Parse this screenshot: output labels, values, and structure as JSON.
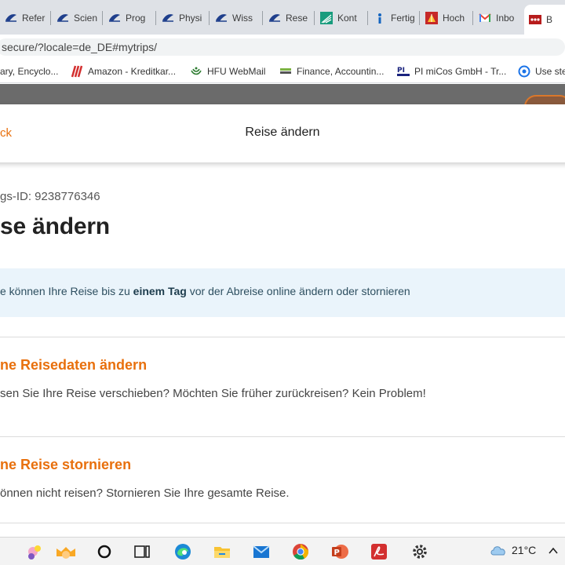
{
  "browser": {
    "tabs": [
      {
        "label": "Refer",
        "icon": "sailboat-icon"
      },
      {
        "label": "Scien",
        "icon": "sailboat-icon"
      },
      {
        "label": "Prog",
        "icon": "sailboat-icon"
      },
      {
        "label": "Physi",
        "icon": "sailboat-icon"
      },
      {
        "label": "Wiss",
        "icon": "sailboat-icon"
      },
      {
        "label": "Rese",
        "icon": "sailboat-icon"
      },
      {
        "label": "Kont",
        "icon": "fraunhofer-icon"
      },
      {
        "label": "Fertig",
        "icon": "info-icon"
      },
      {
        "label": "Hoch",
        "icon": "college-icon"
      },
      {
        "label": "Inbo",
        "icon": "gmail-icon"
      },
      {
        "label": "B",
        "icon": "booking-icon"
      }
    ],
    "url": "secure/?locale=de_DE#mytrips/",
    "bookmarks": [
      {
        "label": "ary, Encyclo...",
        "icon": ""
      },
      {
        "label": "Amazon - Kreditkar...",
        "icon": "amazon-card-icon"
      },
      {
        "label": "HFU WebMail",
        "icon": "hfu-icon"
      },
      {
        "label": "Finance, Accountin...",
        "icon": "finance-icon"
      },
      {
        "label": "PI miCos GmbH - Tr...",
        "icon": "pi-icon"
      },
      {
        "label": "Use ste",
        "icon": "globe-icon"
      }
    ]
  },
  "modal": {
    "back_label": "ck",
    "title": "Reise ändern"
  },
  "page": {
    "booking_id": "gs-ID: 9238776346",
    "heading": "se ändern",
    "info_pre": "e können Ihre Reise bis zu ",
    "info_bold": "einem Tag",
    "info_post": " vor der Abreise online ändern oder stornieren",
    "sections": [
      {
        "title": "ne Reisedaten ändern",
        "desc": "sen Sie Ihre Reise verschieben? Möchten Sie früher zurückreisen? Kein Problem!"
      },
      {
        "title": "ne Reise stornieren",
        "desc": "önnen nicht reisen? Stornieren Sie Ihre gesamte Reise."
      }
    ]
  },
  "taskbar": {
    "apps": [
      "widgets-icon",
      "cortana-icon",
      "task-view-icon",
      "edge-icon",
      "file-explorer-icon",
      "mail-icon",
      "chrome-icon",
      "powerpoint-icon",
      "acrobat-icon",
      "settings-icon"
    ],
    "weather_temp": "21°C",
    "weather_icon": "cloud-icon"
  },
  "colors": {
    "accent": "#e8700d",
    "info_bg": "#eaf4fb",
    "tabstrip_bg": "#dee1e6"
  }
}
